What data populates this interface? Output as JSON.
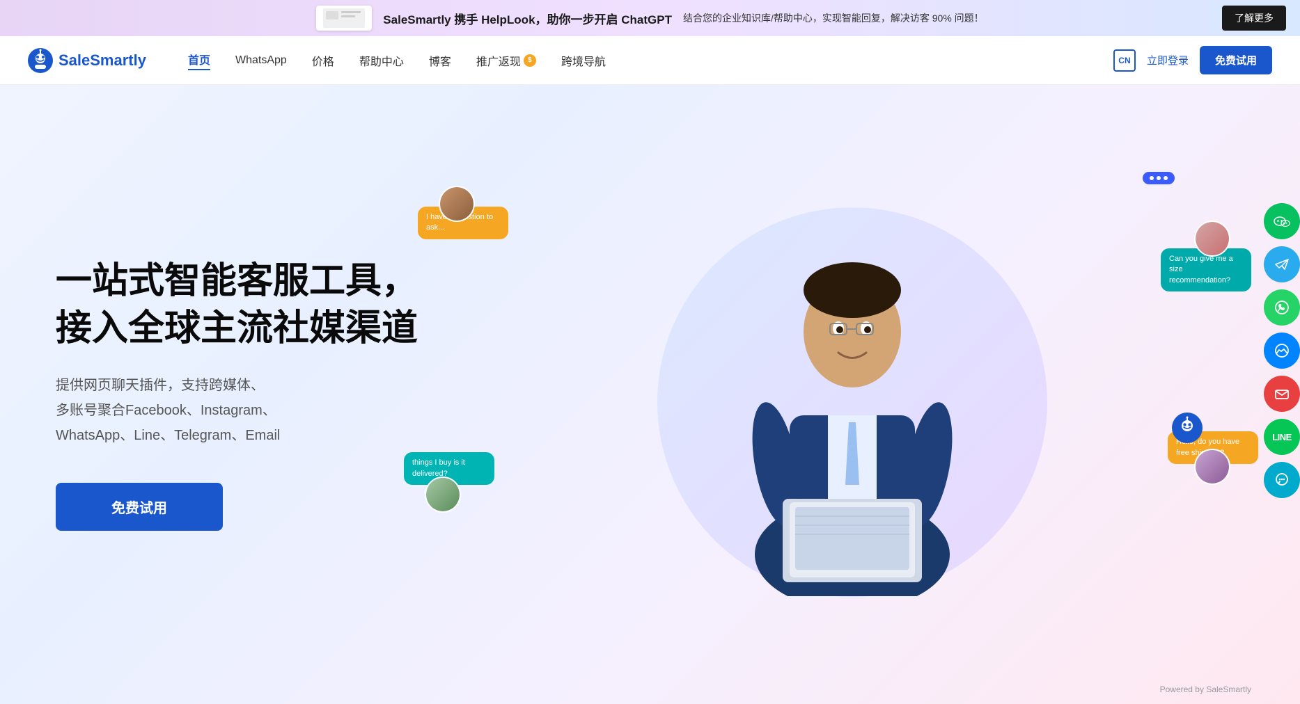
{
  "banner": {
    "main_text": "SaleSmartly 携手 HelpLook，助你一步开启 ChatGPT",
    "sub_text": "结合您的企业知识库/帮助中心，实现智能回复，解决访客 90% 问题！",
    "btn_label": "了解更多"
  },
  "nav": {
    "logo_text": "SaleSmartly",
    "links": [
      {
        "label": "首页",
        "active": true
      },
      {
        "label": "WhatsApp",
        "active": false
      },
      {
        "label": "价格",
        "active": false
      },
      {
        "label": "帮助中心",
        "active": false
      },
      {
        "label": "博客",
        "active": false
      },
      {
        "label": "推广返现",
        "active": false
      },
      {
        "label": "跨境导航",
        "active": false
      }
    ],
    "lang_btn": "CN",
    "login_label": "立即登录",
    "try_label": "免费试用"
  },
  "hero": {
    "title_line1": "一站式智能客服工具，",
    "title_line2": "接入全球主流社媒渠道",
    "subtitle": "提供网页聊天插件，支持跨媒体、\n多账号聚合Facebook、Instagram、\nWhatsApp、Line、Telegram、Email",
    "cta_label": "免费试用"
  },
  "chat_bubbles": [
    {
      "text": "I have a question to ask...",
      "class": "bubble-orange"
    },
    {
      "text": "things I buy is it delivered?",
      "class": "bubble-teal"
    },
    {
      "text": "Can you give me a size recommendation?",
      "class": "bubble-teal2"
    },
    {
      "text": "Hello, do you have free shipping?",
      "class": "bubble-orange2"
    }
  ],
  "social_icons": [
    {
      "label": "wechat",
      "class": "si-wechat",
      "symbol": "💬"
    },
    {
      "label": "telegram",
      "class": "si-telegram",
      "symbol": "✈"
    },
    {
      "label": "whatsapp",
      "class": "si-whatsapp",
      "symbol": "📱"
    },
    {
      "label": "messenger",
      "class": "si-messenger",
      "symbol": "💬"
    },
    {
      "label": "email",
      "class": "si-email",
      "symbol": "✉"
    },
    {
      "label": "line",
      "class": "si-line",
      "symbol": "LINE"
    },
    {
      "label": "chat",
      "class": "si-chat",
      "symbol": "💬"
    }
  ],
  "footer": {
    "note": "Powered by SaleSmartly"
  }
}
